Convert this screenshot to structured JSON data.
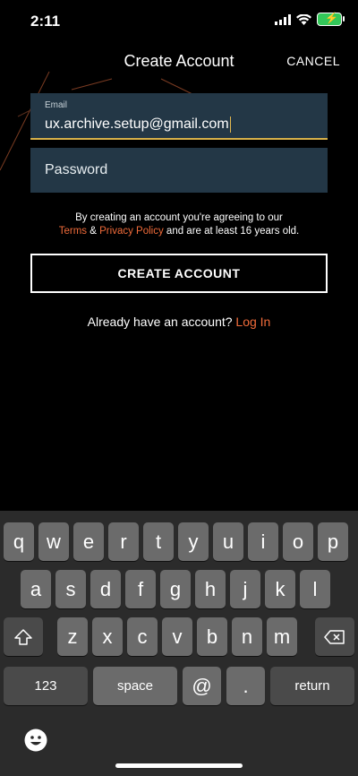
{
  "status": {
    "time": "2:11"
  },
  "header": {
    "title": "Create Account",
    "cancel_label": "CANCEL"
  },
  "form": {
    "email_label": "Email",
    "email_value": "ux.archive.setup@gmail.com",
    "password_label": "Password"
  },
  "terms": {
    "line1": "By creating an account you're agreeing to our",
    "terms_link": "Terms",
    "amp": "&",
    "privacy_link": "Privacy Policy",
    "line2_rest": "and are at least 16 years old."
  },
  "create_button_label": "CREATE ACCOUNT",
  "login": {
    "prompt": "Already have an account?",
    "link": "Log In"
  },
  "keyboard": {
    "row1": [
      "q",
      "w",
      "e",
      "r",
      "t",
      "y",
      "u",
      "i",
      "o",
      "p"
    ],
    "row2": [
      "a",
      "s",
      "d",
      "f",
      "g",
      "h",
      "j",
      "k",
      "l"
    ],
    "row3": [
      "z",
      "x",
      "c",
      "v",
      "b",
      "n",
      "m"
    ],
    "numbers_label": "123",
    "space_label": "space",
    "at_label": "@",
    "dot_label": ".",
    "return_label": "return"
  },
  "colors": {
    "accent": "#f06b3a",
    "field_bg": "#233746",
    "focus_underline": "#d8b24a"
  }
}
